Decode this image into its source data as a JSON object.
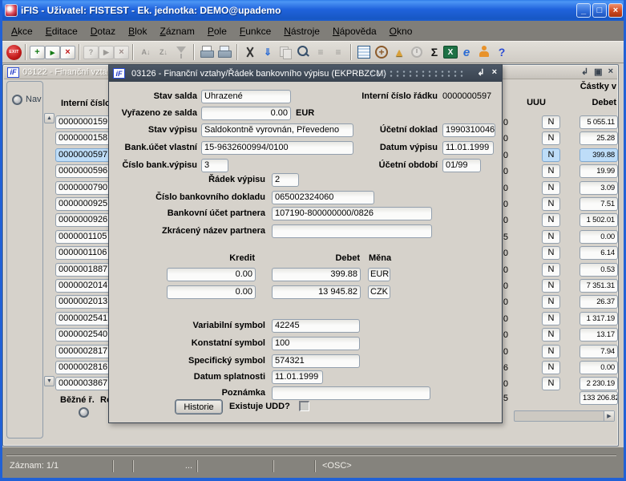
{
  "colors": {
    "titlebar_blue": "#2063DC",
    "close_red": "#D0491F",
    "dialog_titlebar": "#3E4956",
    "selection": "#BEDDF8",
    "menubar_gray": "#807E79",
    "content_gray": "#D6D2CB"
  },
  "titlebar": {
    "title": "iFIS - Uživatel: FISTEST - Ek. jednotka: DEMO@upademo",
    "buttons": [
      {
        "name": "minimize-button",
        "glyph": "_"
      },
      {
        "name": "maximize-button",
        "glyph": "□"
      },
      {
        "name": "close-button",
        "glyph": "×"
      }
    ]
  },
  "menu": {
    "items": [
      "Akce",
      "Editace",
      "Dotaz",
      "Blok",
      "Záznam",
      "Pole",
      "Funkce",
      "Nástroje",
      "Nápověda",
      "Okno"
    ]
  },
  "toolbar": {
    "items": [
      {
        "name": "exit-icon",
        "glyph": "EXIT"
      },
      {
        "name": "separator"
      },
      {
        "name": "insert-record-icon",
        "glyph": "+"
      },
      {
        "name": "accept-record-icon",
        "glyph": "▸"
      },
      {
        "name": "delete-record-icon",
        "glyph": "×"
      },
      {
        "name": "separator"
      },
      {
        "name": "enter-query-icon",
        "glyph": "?",
        "disabled": true
      },
      {
        "name": "execute-query-icon",
        "glyph": "▶",
        "disabled": true
      },
      {
        "name": "cancel-query-icon",
        "glyph": "×",
        "disabled": true
      },
      {
        "name": "separator"
      },
      {
        "name": "sort-asc-icon",
        "glyph": "A↓",
        "disabled": true
      },
      {
        "name": "sort-desc-icon",
        "glyph": "Z↓",
        "disabled": true
      },
      {
        "name": "filter-icon",
        "glyph": "",
        "disabled": true
      },
      {
        "name": "separator"
      },
      {
        "name": "print-icon",
        "glyph": ""
      },
      {
        "name": "print-preview-icon",
        "glyph": ""
      },
      {
        "name": "separator"
      },
      {
        "name": "cut-icon",
        "glyph": ""
      },
      {
        "name": "paste-icon",
        "glyph": "⇓"
      },
      {
        "name": "copy-icon",
        "glyph": "",
        "disabled": true
      },
      {
        "name": "find-icon",
        "glyph": ""
      },
      {
        "name": "list-values-icon",
        "glyph": "≡",
        "disabled": true
      },
      {
        "name": "list-tree-icon",
        "glyph": "≡",
        "disabled": true
      },
      {
        "name": "separator"
      },
      {
        "name": "detail-form-icon",
        "glyph": ""
      },
      {
        "name": "navigator-icon",
        "glyph": "+"
      },
      {
        "name": "prism-icon",
        "glyph": "▲"
      },
      {
        "name": "clock-icon",
        "glyph": "",
        "disabled": true
      },
      {
        "name": "sum-icon",
        "glyph": "Σ"
      },
      {
        "name": "excel-icon",
        "glyph": "X"
      },
      {
        "name": "browser-icon",
        "glyph": "e"
      },
      {
        "name": "help-icon",
        "glyph": ""
      },
      {
        "name": "question-icon",
        "glyph": "?"
      }
    ]
  },
  "bg_window": {
    "title": "03122 - Finanční vzta",
    "controls": [
      {
        "name": "restore-icon",
        "glyph": "↲"
      },
      {
        "name": "maximize-icon",
        "glyph": "▣"
      },
      {
        "name": "close-icon",
        "glyph": "×"
      }
    ],
    "nav_label": "Nav",
    "list_header": "Interní číslo",
    "amounts_header": "Částky v",
    "col_uuu": "UUU",
    "col_debet": "Debet",
    "selected_index": 2,
    "rows": [
      {
        "id": "0000000159",
        "flag": "0",
        "uuu": "N",
        "debet": "5 055.11"
      },
      {
        "id": "0000000158",
        "flag": "0",
        "uuu": "N",
        "debet": "25.28"
      },
      {
        "id": "0000000597",
        "flag": "0",
        "uuu": "N",
        "debet": "399.88"
      },
      {
        "id": "0000000596",
        "flag": "0",
        "uuu": "N",
        "debet": "19.99"
      },
      {
        "id": "0000000790",
        "flag": "0",
        "uuu": "N",
        "debet": "3.09"
      },
      {
        "id": "0000000925",
        "flag": "0",
        "uuu": "N",
        "debet": "7.51"
      },
      {
        "id": "0000000926",
        "flag": "0",
        "uuu": "N",
        "debet": "1 502.01"
      },
      {
        "id": "0000001105",
        "flag": "5",
        "uuu": "N",
        "debet": "0.00"
      },
      {
        "id": "0000001106",
        "flag": "0",
        "uuu": "N",
        "debet": "6.14"
      },
      {
        "id": "0000001887",
        "flag": "0",
        "uuu": "N",
        "debet": "0.53"
      },
      {
        "id": "0000002014",
        "flag": "0",
        "uuu": "N",
        "debet": "7 351.31"
      },
      {
        "id": "0000002013",
        "flag": "0",
        "uuu": "N",
        "debet": "26.37"
      },
      {
        "id": "0000002541",
        "flag": "0",
        "uuu": "N",
        "debet": "1 317.19"
      },
      {
        "id": "0000002540",
        "flag": "0",
        "uuu": "N",
        "debet": "13.17"
      },
      {
        "id": "0000002817",
        "flag": "0",
        "uuu": "N",
        "debet": "7.94"
      },
      {
        "id": "0000002816",
        "flag": "6",
        "uuu": "N",
        "debet": "0.00"
      },
      {
        "id": "0000003867",
        "flag": "0",
        "uuu": "N",
        "debet": "2 230.19"
      }
    ],
    "total_flag": "5",
    "total_debet": "133 206.82",
    "bezne_label": "Běžné ř.",
    "rozpis_label": "Rozpi"
  },
  "dialog": {
    "title": "03126 - Finanční vztahy/Řádek bankovního výpisu (EKPRBZCM)",
    "controls": [
      {
        "name": "minimize-icon",
        "glyph": "↲"
      },
      {
        "name": "close-icon",
        "glyph": "×"
      }
    ],
    "stav_salda": {
      "label": "Stav salda",
      "value": "Uhrazené"
    },
    "interni_cislo_radku": {
      "label": "Interní číslo řádku",
      "value": "0000000597"
    },
    "vyrazeno_ze_salda": {
      "label": "Vyřazeno ze salda",
      "value": "0.00",
      "currency": "EUR"
    },
    "stav_vypisu": {
      "label": "Stav výpisu",
      "value": "Saldokontně vyrovnán, Převedeno"
    },
    "ucetni_doklad": {
      "label": "Účetní doklad",
      "value": "1990310046"
    },
    "bank_ucet_vlastni": {
      "label": "Bank.účet vlastní",
      "value": "15-9632600994/0100"
    },
    "datum_vypisu": {
      "label": "Datum výpisu",
      "value": "11.01.1999"
    },
    "cislo_bank_vypisu": {
      "label": "Číslo bank.výpisu",
      "value": "3"
    },
    "ucetni_obdobi": {
      "label": "Účetní období",
      "value": "01/99"
    },
    "radek_vypisu": {
      "label": "Řádek výpisu",
      "value": "2"
    },
    "cislo_bankovniho_dokladu": {
      "label": "Číslo bankovního dokladu",
      "value": "065002324060"
    },
    "bankovni_ucet_partnera": {
      "label": "Bankovní účet partnera",
      "value": "107190-800000000/0826"
    },
    "zkraceny_nazev_partnera": {
      "label": "Zkrácený název partnera",
      "value": ""
    },
    "headers": {
      "kredit": "Kredit",
      "debet": "Debet",
      "mena": "Měna"
    },
    "amounts": [
      {
        "kredit": "0.00",
        "debet": "399.88",
        "mena": "EUR"
      },
      {
        "kredit": "0.00",
        "debet": "13 945.82",
        "mena": "CZK"
      }
    ],
    "variabilni_symbol": {
      "label": "Variabilní symbol",
      "value": "42245"
    },
    "konstatni_symbol": {
      "label": "Konstatní symbol",
      "value": "100"
    },
    "specificky_symbol": {
      "label": "Specifický symbol",
      "value": "574321"
    },
    "datum_splatnosti": {
      "label": "Datum splatnosti",
      "value": "11.01.1999"
    },
    "poznamka": {
      "label": "Poznámka",
      "value": ""
    },
    "historie_label": "Historie",
    "existuje_udd_label": "Existuje UDD?"
  },
  "statusbar": {
    "zaznam": "Záznam: 1/1",
    "dots": "...",
    "osc": "<OSC>"
  }
}
